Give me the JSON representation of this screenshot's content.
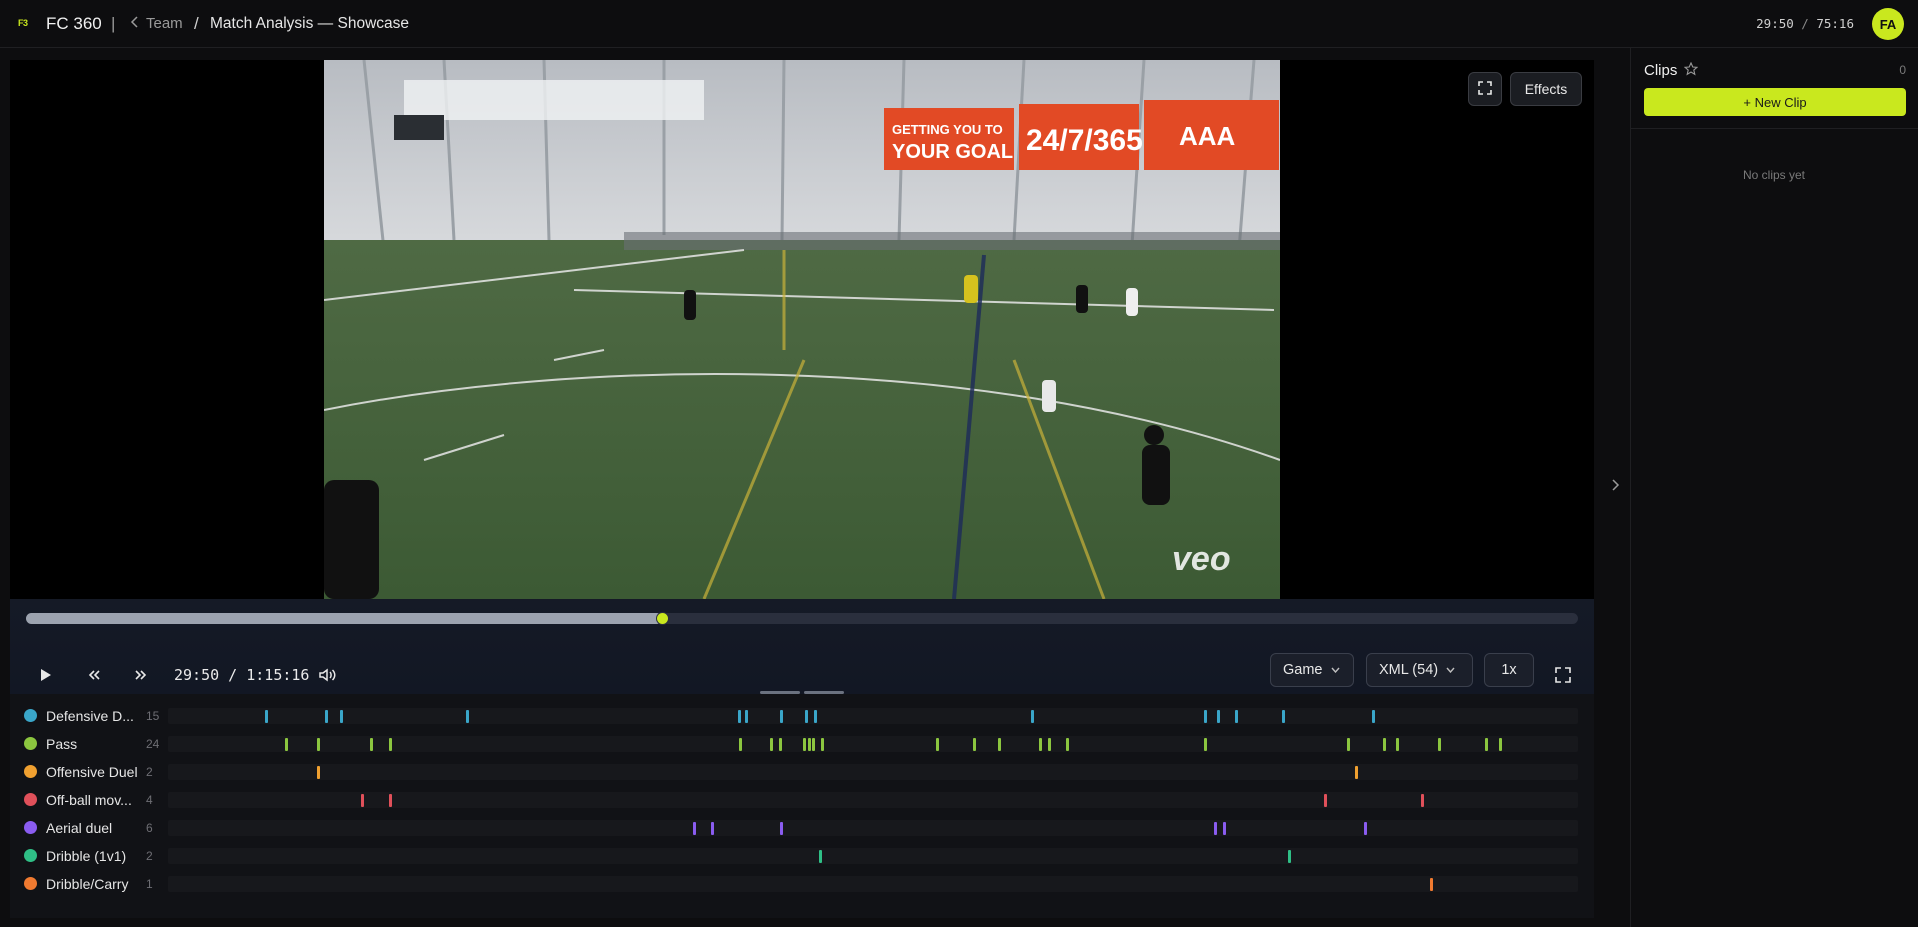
{
  "header": {
    "logo_text": "F3",
    "brand": "FC 360",
    "separator": "|",
    "back_label": "Team",
    "crumb_separator": "/",
    "title": "Match Analysis — Showcase",
    "time_current": "29:50",
    "time_sep": " / ",
    "time_total": "75:16",
    "avatar_initials": "FA"
  },
  "player": {
    "effects_label": "Effects",
    "progress": 0.41,
    "timecode": "29:50 / 1:15:16",
    "period_select": "Game",
    "xml_select": "XML (54)",
    "speed_label": "1x",
    "video_watermark": "veo",
    "banner_text_1": "GETTING YOU TO YOUR GOAL",
    "banner_text_2": "24/7/365",
    "banner_text_3": "AAA"
  },
  "events": [
    {
      "label": "Defensive D...",
      "count": "15",
      "color": "#3aa6c9",
      "marks": [
        0.069,
        0.111,
        0.122,
        0.211,
        0.404,
        0.409,
        0.434,
        0.452,
        0.458,
        0.612,
        0.735,
        0.744,
        0.757,
        0.79,
        0.854
      ]
    },
    {
      "label": "Pass",
      "count": "24",
      "color": "#8cc63f",
      "marks": [
        0.083,
        0.106,
        0.143,
        0.157,
        0.405,
        0.427,
        0.433,
        0.45,
        0.454,
        0.457,
        0.463,
        0.545,
        0.571,
        0.589,
        0.618,
        0.624,
        0.637,
        0.735,
        0.836,
        0.862,
        0.871,
        0.901,
        0.934,
        0.944
      ]
    },
    {
      "label": "Offensive Duel",
      "count": "2",
      "color": "#f0a030",
      "marks": [
        0.106,
        0.842
      ]
    },
    {
      "label": "Off-ball mov...",
      "count": "4",
      "color": "#e0505a",
      "marks": [
        0.137,
        0.157,
        0.82,
        0.889
      ]
    },
    {
      "label": "Aerial duel",
      "count": "6",
      "color": "#8a5cf0",
      "marks": [
        0.372,
        0.385,
        0.434,
        0.742,
        0.748,
        0.848
      ]
    },
    {
      "label": "Dribble (1v1)",
      "count": "2",
      "color": "#2fbf86",
      "marks": [
        0.462,
        0.794
      ]
    },
    {
      "label": "Dribble/Carry",
      "count": "1",
      "color": "#f07a30",
      "marks": [
        0.895
      ]
    }
  ],
  "clips": {
    "title": "Clips",
    "count": "0",
    "new_clip_label": "+ New Clip",
    "empty_text": "No clips yet"
  },
  "colors": {
    "accent": "#c9e81e",
    "background": "#0d0d0f",
    "panel": "#111216"
  }
}
